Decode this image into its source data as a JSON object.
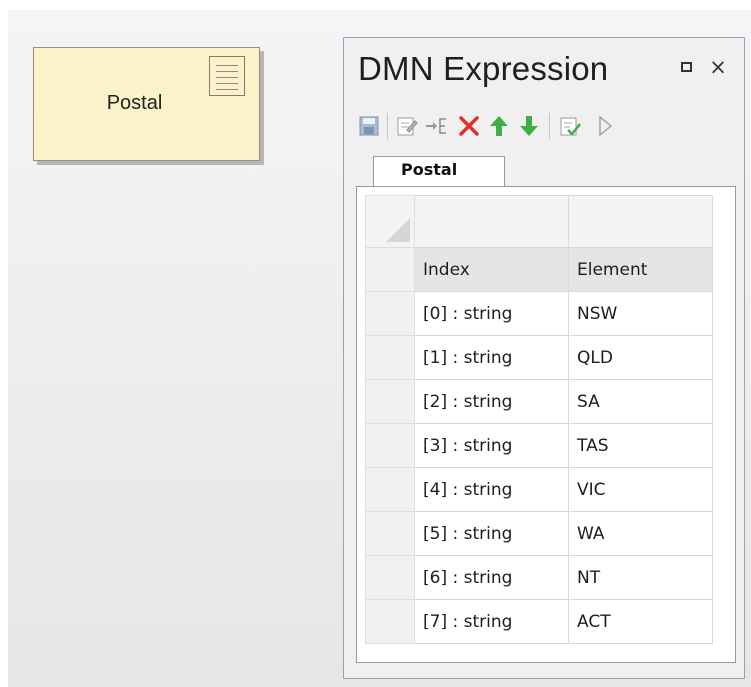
{
  "diagram": {
    "element_name": "Postal",
    "element_icon": "document-icon"
  },
  "window": {
    "title": "DMN Expression",
    "restore_icon": "restore-icon",
    "close_glyph": "×",
    "toolbar": [
      {
        "name": "save-icon",
        "enabled": false
      },
      {
        "name": "edit-icon",
        "enabled": false
      },
      {
        "name": "add-row-icon",
        "enabled": false
      },
      {
        "name": "delete-icon",
        "color": "#e0302e"
      },
      {
        "name": "move-up-icon",
        "color": "#3fae49"
      },
      {
        "name": "move-down-icon",
        "color": "#3fae49"
      },
      {
        "name": "validate-icon"
      },
      {
        "name": "play-icon",
        "enabled": false
      }
    ],
    "tab": "Postal",
    "table": {
      "headers": [
        "Index",
        "Element"
      ],
      "rows": [
        {
          "index": "[0] : string",
          "element": "NSW"
        },
        {
          "index": "[1] : string",
          "element": "QLD"
        },
        {
          "index": "[2] : string",
          "element": "SA"
        },
        {
          "index": "[3] : string",
          "element": "TAS"
        },
        {
          "index": "[4] : string",
          "element": "VIC"
        },
        {
          "index": "[5] : string",
          "element": "WA"
        },
        {
          "index": "[6] : string",
          "element": "NT"
        },
        {
          "index": "[7] : string",
          "element": "ACT"
        }
      ]
    }
  }
}
